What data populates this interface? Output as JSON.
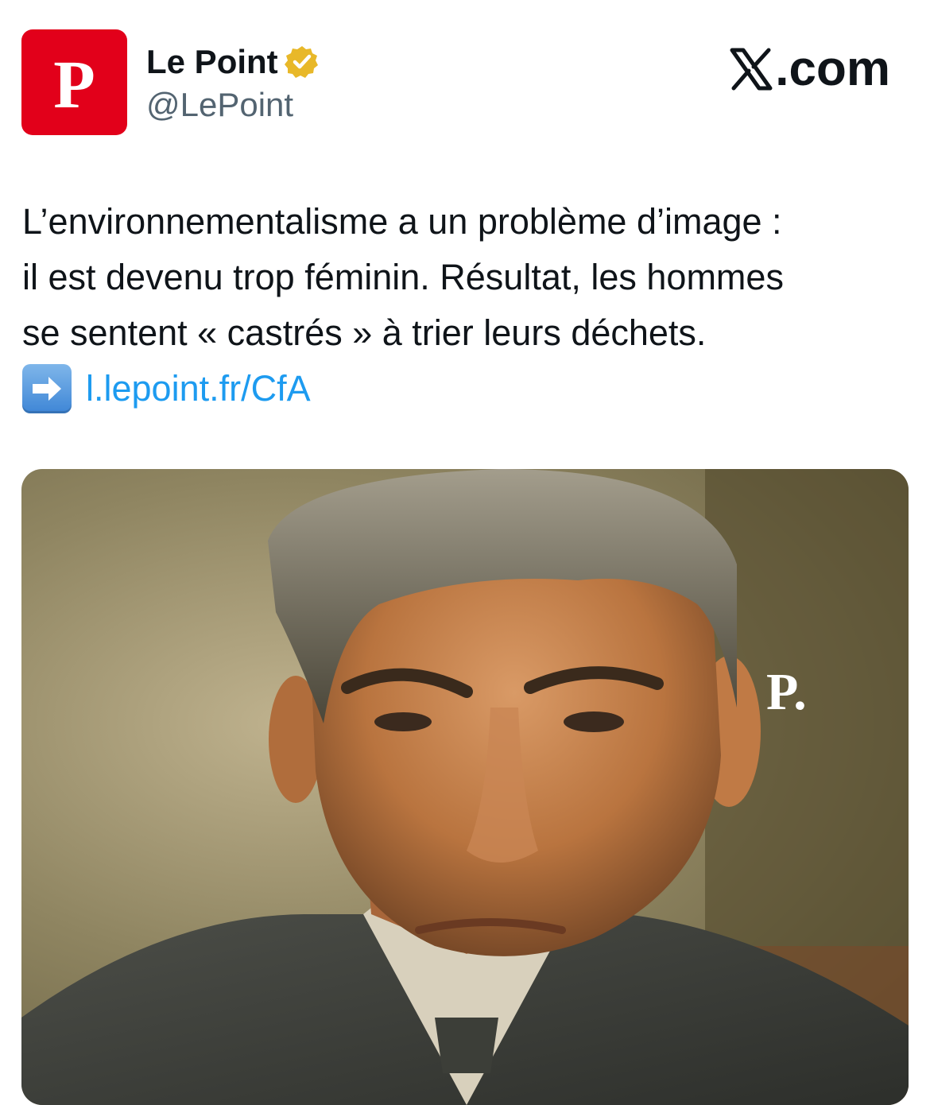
{
  "account": {
    "display_name": "Le Point",
    "handle": "@LePoint",
    "avatar_letter": "P",
    "avatar_color": "#e2001a",
    "verified_badge_color": "#e8b829",
    "verified_icon": "verified-badge-icon"
  },
  "brand": {
    "label": ".com",
    "icon": "x-logo-icon"
  },
  "tweet": {
    "text": "L’environnementalisme a un problème d’image :\nil est devenu trop féminin. Résultat, les hommes\nse sentent « castrés » à trier leurs déchets.",
    "link_icon": "right-arrow-emoji-icon",
    "link_text": "l.lepoint.fr/CfA",
    "link_color": "#1d9bf0"
  },
  "media": {
    "watermark": "P.",
    "description_icon": "painted-portrait-image"
  }
}
